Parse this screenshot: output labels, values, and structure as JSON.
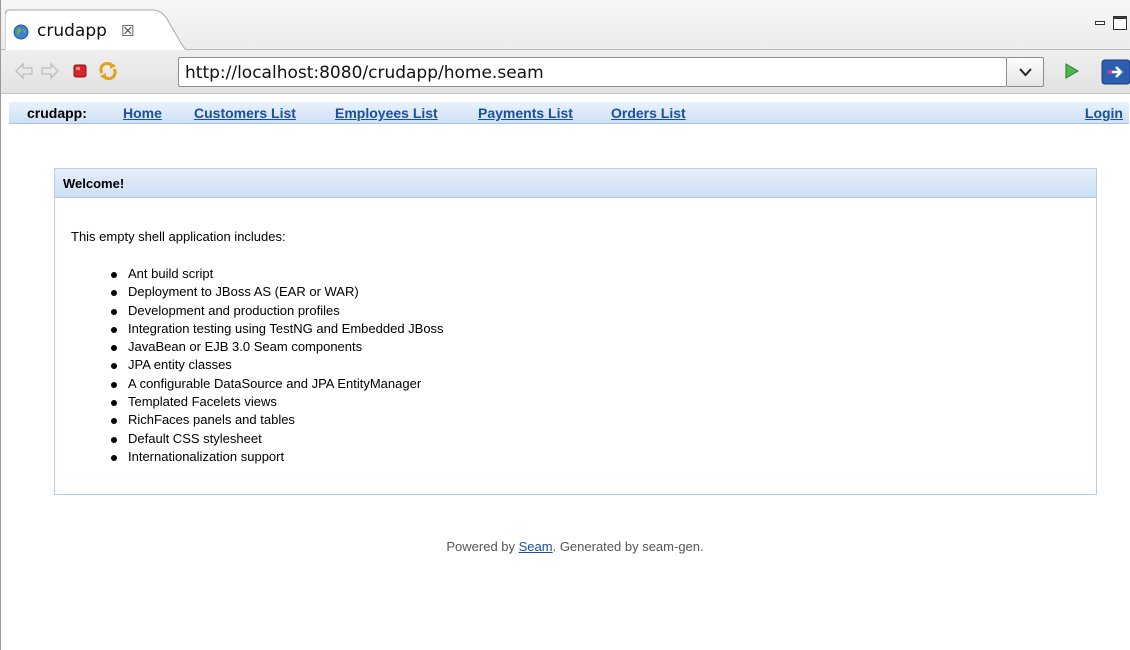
{
  "browser": {
    "tab_title": "crudapp",
    "tab_close_glyph": "☒",
    "url": "http://localhost:8080/crudapp/home.seam",
    "icons": {
      "tab": "globe-icon",
      "back": "back-arrow-icon",
      "forward": "forward-arrow-icon",
      "stop": "stop-icon",
      "refresh": "refresh-icon",
      "go": "go-icon",
      "external": "open-external-icon"
    }
  },
  "app": {
    "brand": "crudapp:",
    "nav": [
      {
        "label": "Home"
      },
      {
        "label": "Customers List"
      },
      {
        "label": "Employees List"
      },
      {
        "label": "Payments List"
      },
      {
        "label": "Orders List"
      }
    ],
    "login": "Login"
  },
  "panel": {
    "title": "Welcome!",
    "intro": "This empty shell application includes:",
    "items": [
      "Ant build script",
      "Deployment to JBoss AS (EAR or WAR)",
      "Development and production profiles",
      "Integration testing using TestNG and Embedded JBoss",
      "JavaBean or EJB 3.0 Seam components",
      "JPA entity classes",
      "A configurable DataSource and JPA EntityManager",
      "Templated Facelets views",
      "RichFaces panels and tables",
      "Default CSS stylesheet",
      "Internationalization support"
    ]
  },
  "footer": {
    "prefix": "Powered by ",
    "link": "Seam",
    "suffix": ". Generated by seam-gen."
  },
  "colors": {
    "link": "#1c4f9c",
    "menubar": "#d9e7f8",
    "panel_border": "#b5cde8"
  }
}
